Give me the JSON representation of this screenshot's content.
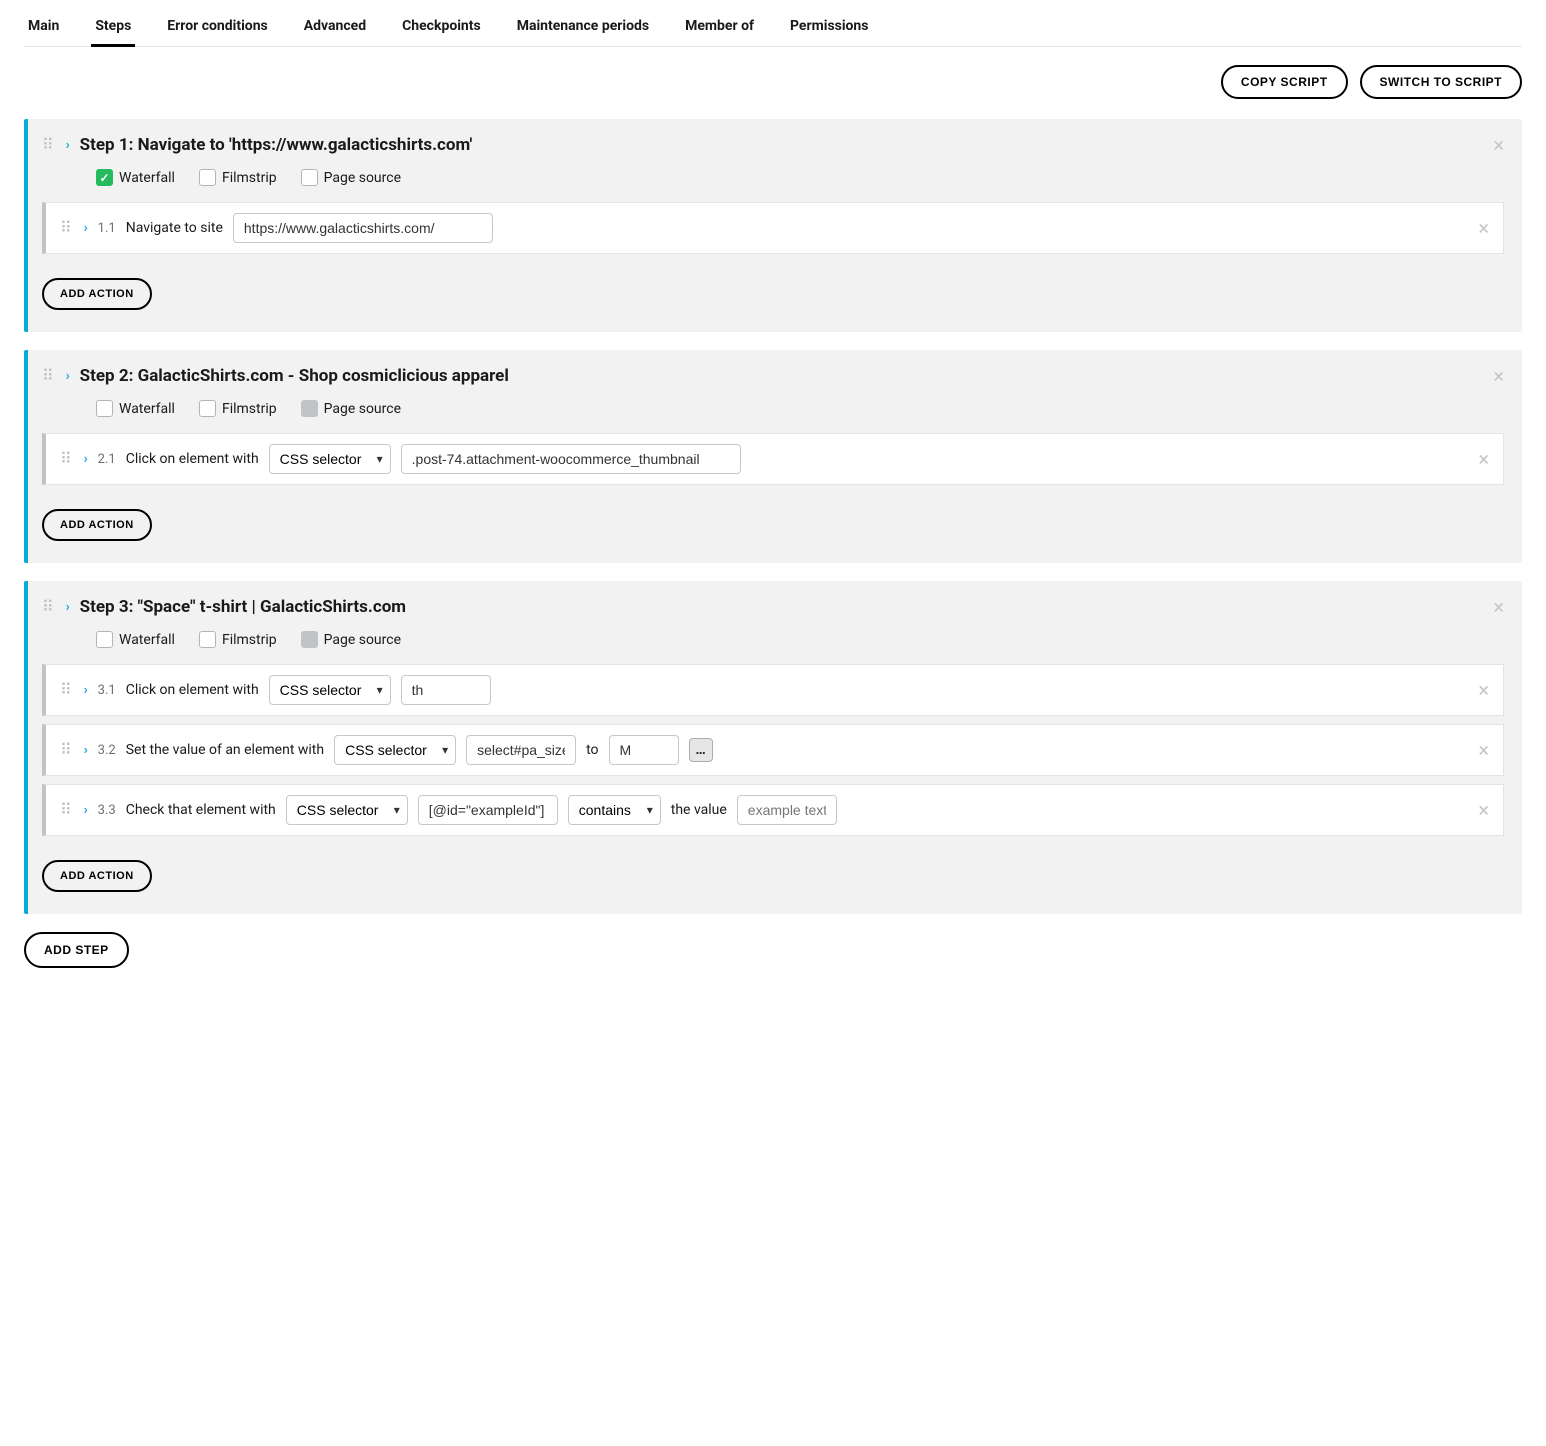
{
  "tabs": {
    "main": "Main",
    "steps": "Steps",
    "error_conditions": "Error conditions",
    "advanced": "Advanced",
    "checkpoints": "Checkpoints",
    "maintenance": "Maintenance periods",
    "member_of": "Member of",
    "permissions": "Permissions"
  },
  "top_buttons": {
    "copy": "COPY SCRIPT",
    "switch": "SWITCH TO SCRIPT"
  },
  "options": {
    "waterfall": "Waterfall",
    "filmstrip": "Filmstrip",
    "pagesource": "Page source"
  },
  "common": {
    "add_action": "ADD ACTION",
    "add_step": "ADD STEP",
    "css_selector": "CSS selector",
    "to": "to",
    "the_value": "the value"
  },
  "step1": {
    "title": "Step 1: Navigate to 'https://www.galacticshirts.com'",
    "a1_num": "1.1",
    "a1_text": "Navigate to site",
    "a1_url": "https://www.galacticshirts.com/"
  },
  "step2": {
    "title": "Step 2: GalacticShirts.com - Shop cosmiclicious apparel",
    "a1_num": "2.1",
    "a1_text": "Click on element with",
    "a1_selector_value": ".post-74.attachment-woocommerce_thumbnail"
  },
  "step3": {
    "title": "Step 3: \"Space\" t-shirt | GalacticShirts.com",
    "a1_num": "3.1",
    "a1_text": "Click on element with",
    "a1_value": "th",
    "a2_num": "3.2",
    "a2_text": "Set the value of an element with",
    "a2_selector_value": "select#pa_size",
    "a2_to_value": "M",
    "a3_num": "3.3",
    "a3_text": "Check that element with",
    "a3_selector_value": "[@id=\"exampleId\"]",
    "a3_condition": "contains",
    "a3_value_placeholder": "example text"
  }
}
